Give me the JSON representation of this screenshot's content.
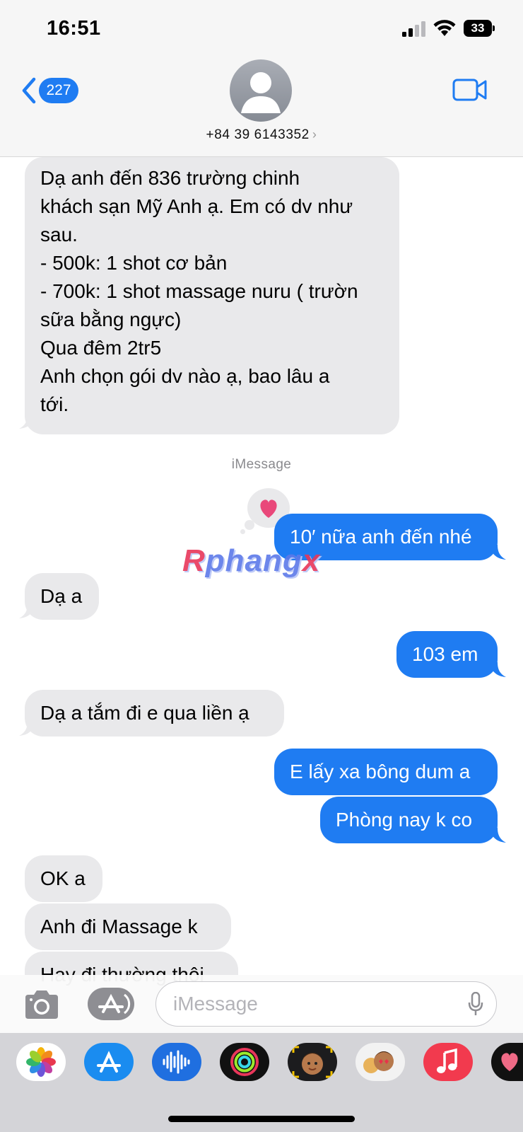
{
  "status_bar": {
    "time": "16:51",
    "battery": "33"
  },
  "header": {
    "back_count": "227",
    "contact_number": "+84 39 6143352",
    "chevron": "›"
  },
  "messages": [
    {
      "id": "m1",
      "direction": "incoming",
      "text": "Dạ anh đến 836 trường chinh\nkhách sạn Mỹ Anh  ạ. Em có dv như\nsau.\n- 500k: 1 shot cơ bản\n- 700k: 1 shot massage nuru ( trườn\nsữa bằng ngực)\nQua đêm 2tr5\nAnh chọn gói dv nào ạ, bao lâu a\ntới."
    },
    {
      "id": "m2",
      "direction": "outgoing",
      "text": "10′ nữa anh đến nhé",
      "tapback": "heart"
    },
    {
      "id": "m3",
      "direction": "incoming",
      "text": "Dạ a"
    },
    {
      "id": "m4",
      "direction": "outgoing",
      "text": "103 em"
    },
    {
      "id": "m5",
      "direction": "incoming",
      "text": "Dạ a tắm đi e qua liền ạ"
    },
    {
      "id": "m6",
      "direction": "outgoing",
      "text": "E lấy xa bông dum a"
    },
    {
      "id": "m7",
      "direction": "outgoing",
      "text": "Phòng nay k co"
    },
    {
      "id": "m8",
      "direction": "incoming",
      "text": "OK a"
    },
    {
      "id": "m9",
      "direction": "incoming",
      "text": "Anh đi Massage k"
    },
    {
      "id": "m10",
      "direction": "incoming",
      "text": "Hay đi thường thôi"
    }
  ],
  "service_label": "iMessage",
  "watermark": {
    "part1": "R",
    "part2": "phang",
    "part3": "x"
  },
  "input": {
    "placeholder": "iMessage"
  },
  "app_strip": [
    "photos-app",
    "app-store-app",
    "audio-message-app",
    "activity-app",
    "memoji-app",
    "memoji-stickers-app",
    "music-app",
    "heart-stickers-app"
  ],
  "colors": {
    "outgoing": "#1f7cf2",
    "incoming": "#e9e9eb",
    "accent": "#1f7cf2"
  }
}
